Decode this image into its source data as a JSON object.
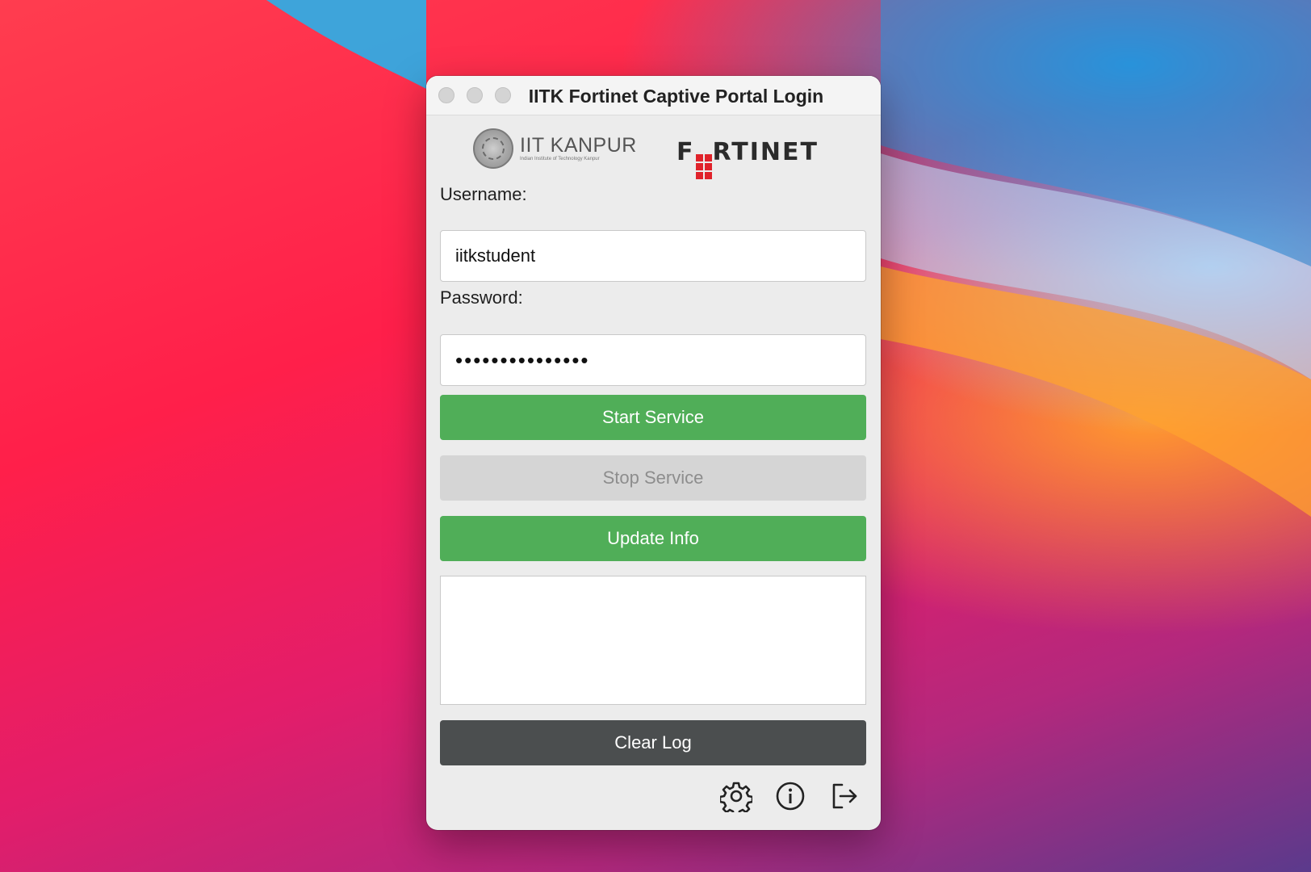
{
  "window": {
    "title": "IITK Fortinet Captive Portal Login"
  },
  "logos": {
    "iitk_name": "IIT KANPUR",
    "iitk_subtitle": "Indian Institute of Technology Kanpur",
    "fortinet": "FORTINET"
  },
  "form": {
    "username_label": "Username:",
    "username_value": "iitkstudent",
    "password_label": "Password:",
    "password_value": "•••••••••••••••"
  },
  "buttons": {
    "start": "Start Service",
    "stop": "Stop Service",
    "update": "Update Info",
    "clear": "Clear Log"
  },
  "log": {
    "text": ""
  },
  "footer_icons": [
    "gear-icon",
    "info-icon",
    "logout-icon"
  ],
  "colors": {
    "green": "#50ae58",
    "disabled": "#d5d5d5",
    "dark": "#4b4e4f",
    "fortinet_red": "#e0222a"
  }
}
